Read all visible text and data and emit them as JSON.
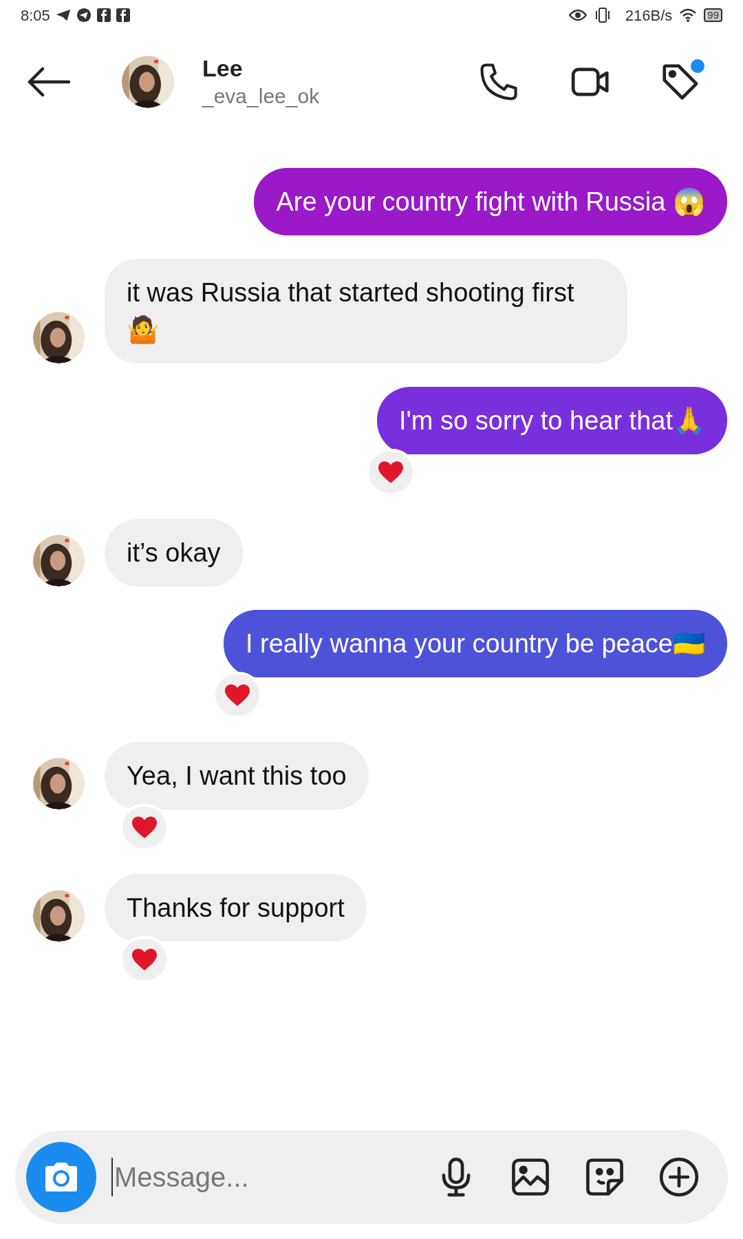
{
  "status_bar": {
    "time": "8:05",
    "speed": "216B/s",
    "battery": "99"
  },
  "header": {
    "name": "Lee",
    "username": "_eva_lee_ok",
    "tag_badge": true
  },
  "messages": [
    {
      "kind": "outgoing",
      "text": "Are your country fight with Russia 😱",
      "color": "#9a19c8",
      "reacted": false
    },
    {
      "kind": "incoming",
      "text": "it was Russia that started shooting first🤷",
      "reacted": false
    },
    {
      "kind": "outgoing",
      "text": "I'm so sorry to hear that🙏",
      "color": "#7a2fdc",
      "reacted": true
    },
    {
      "kind": "incoming",
      "text": "it’s okay",
      "reacted": false
    },
    {
      "kind": "outgoing",
      "text": "I really wanna your country be peace🇺🇦",
      "color": "#4d52d9",
      "reacted": true
    },
    {
      "kind": "incoming",
      "text": "Yea, I want this too",
      "reacted": true
    },
    {
      "kind": "incoming",
      "text": "Thanks for support",
      "reacted": true
    }
  ],
  "composer": {
    "placeholder": "Message..."
  }
}
